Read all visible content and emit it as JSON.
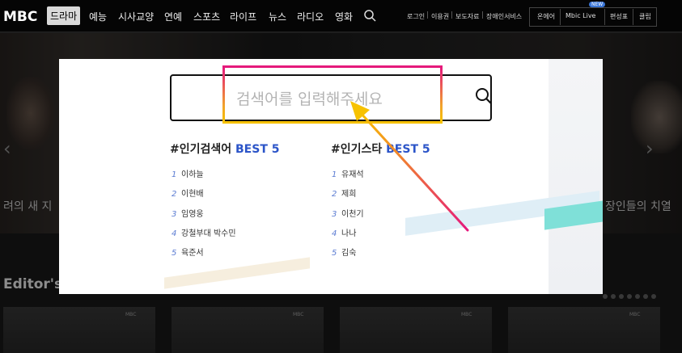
{
  "brand": {
    "logo": "MBC"
  },
  "nav": {
    "items": [
      "드라마",
      "예능",
      "시사교양",
      "연예",
      "스포츠",
      "라이프",
      "뉴스",
      "라디오",
      "영화"
    ],
    "active_index": 0
  },
  "util_links": [
    "로그인",
    "이용권",
    "보도자료",
    "장애인서비스"
  ],
  "util_buttons": {
    "onair": "온에어",
    "mbic_live": "Mbic Live",
    "new_badge": "NEW",
    "schedule": "편성표",
    "clip": "클립"
  },
  "background": {
    "left_caption": "려의 새 지",
    "right_caption": "장인들의 치열",
    "editor_title": "Editor's p",
    "thumb_logo": "MBC"
  },
  "search": {
    "placeholder": "검색어를 입력해주세요",
    "popular_search": {
      "title_prefix": "#인기검색어",
      "title_accent": "BEST 5",
      "items": [
        "이하늘",
        "이현배",
        "임영웅",
        "강철부대 박수민",
        "육준서"
      ]
    },
    "popular_star": {
      "title_prefix": "#인기스타",
      "title_accent": "BEST 5",
      "items": [
        "유재석",
        "제희",
        "이천기",
        "나나",
        "김숙"
      ]
    }
  },
  "colors": {
    "accent_blue": "#2b54c8",
    "highlight_pink": "#e5187c",
    "highlight_yellow": "#f7c200",
    "arrow_orange": "#f1a22d"
  }
}
